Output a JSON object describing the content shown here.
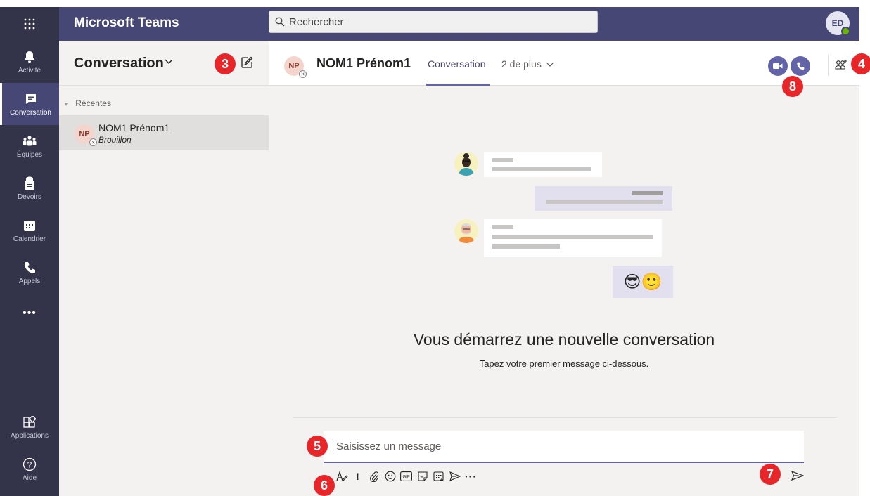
{
  "app": {
    "title": "Microsoft Teams",
    "user_initials": "ED"
  },
  "search": {
    "placeholder": "Rechercher"
  },
  "rail": [
    {
      "label": "Activité",
      "icon": "bell-icon"
    },
    {
      "label": "Conversation",
      "icon": "chat-icon",
      "active": true
    },
    {
      "label": "Équipes",
      "icon": "teams-icon"
    },
    {
      "label": "Devoirs",
      "icon": "assignments-icon"
    },
    {
      "label": "Calendrier",
      "icon": "calendar-icon"
    },
    {
      "label": "Appels",
      "icon": "phone-icon"
    },
    {
      "label": "•••",
      "icon": "more-icon"
    }
  ],
  "rail_bottom": [
    {
      "label": "Applications",
      "icon": "apps-icon"
    },
    {
      "label": "Aide",
      "icon": "help-icon"
    }
  ],
  "list": {
    "title": "Conversation",
    "section": "Récentes",
    "items": [
      {
        "initials": "NP",
        "name": "NOM1 Prénom1",
        "status": "Brouillon"
      }
    ]
  },
  "header": {
    "initials": "NP",
    "name": "NOM1 Prénom1",
    "tab_active": "Conversation",
    "tab_more": "2 de plus"
  },
  "empty_state": {
    "title": "Vous démarrez une nouvelle conversation",
    "subtitle": "Tapez votre premier message ci-dessous."
  },
  "compose": {
    "placeholder": "Saisissez un message"
  },
  "markers": {
    "m3": "3",
    "m4": "4",
    "m5": "5",
    "m6": "6",
    "m7": "7",
    "m8": "8"
  },
  "colors": {
    "brand": "#464775",
    "rail": "#33344a",
    "accent": "#6264a7",
    "marker": "#e8262a"
  },
  "emojis": "😎🙂"
}
